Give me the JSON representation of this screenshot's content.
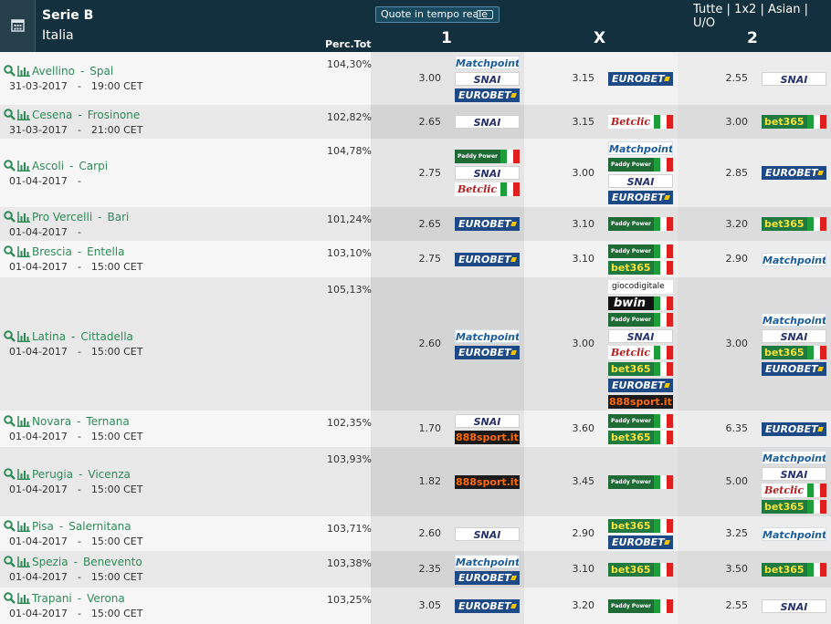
{
  "header": {
    "league": "Serie B",
    "country": "Italia",
    "perc_label": "Perc.Tot",
    "realtime_label": "Quote in tempo reale",
    "filters": [
      "Tutte",
      "1x2",
      "Asian",
      "U/O"
    ],
    "col_1": "1",
    "col_x": "X",
    "col_2": "2"
  },
  "matches": [
    {
      "home": "Avellino",
      "away": "Spal",
      "date": "31-03-2017",
      "sep": "-",
      "time": "19:00 CET",
      "pct": "104,30%",
      "odd1": "3.00",
      "oddx": "3.15",
      "odd2": "2.55",
      "books1": [
        {
          "label": "Matchpoint",
          "type": "matchpoint"
        },
        {
          "label": "SNAI",
          "type": "snai"
        },
        {
          "label": "EUROBET",
          "type": "eurobet"
        }
      ],
      "booksx": [
        {
          "label": "EUROBET",
          "type": "eurobet"
        }
      ],
      "books2": [
        {
          "label": "SNAI",
          "type": "snai"
        }
      ]
    },
    {
      "home": "Cesena",
      "away": "Frosinone",
      "date": "31-03-2017",
      "sep": "-",
      "time": "21:00 CET",
      "pct": "102,82%",
      "odd1": "2.65",
      "oddx": "3.15",
      "odd2": "3.00",
      "books1": [
        {
          "label": "SNAI",
          "type": "snai"
        }
      ],
      "booksx": [
        {
          "label": "Betclic",
          "type": "betclic",
          "flag": true
        }
      ],
      "books2": [
        {
          "label": "bet365",
          "type": "bet365",
          "flag": true
        }
      ]
    },
    {
      "home": "Ascoli",
      "away": "Carpi",
      "date": "01-04-2017",
      "sep": "-",
      "time": "",
      "pct": "104,78%",
      "odd1": "2.75",
      "oddx": "3.00",
      "odd2": "2.85",
      "books1": [
        {
          "label": "Paddy Power",
          "type": "paddy",
          "flag": true
        },
        {
          "label": "SNAI",
          "type": "snai"
        },
        {
          "label": "Betclic",
          "type": "betclic",
          "flag": true
        }
      ],
      "booksx": [
        {
          "label": "Matchpoint",
          "type": "matchpoint"
        },
        {
          "label": "Paddy Power",
          "type": "paddy",
          "flag": true
        },
        {
          "label": "SNAI",
          "type": "snai"
        },
        {
          "label": "EUROBET",
          "type": "eurobet"
        }
      ],
      "books2": [
        {
          "label": "EUROBET",
          "type": "eurobet"
        }
      ]
    },
    {
      "home": "Pro Vercelli",
      "away": "Bari",
      "date": "01-04-2017",
      "sep": "-",
      "time": "",
      "pct": "101,24%",
      "odd1": "2.65",
      "oddx": "3.10",
      "odd2": "3.20",
      "books1": [
        {
          "label": "EUROBET",
          "type": "eurobet"
        }
      ],
      "booksx": [
        {
          "label": "Paddy Power",
          "type": "paddy",
          "flag": true
        }
      ],
      "books2": [
        {
          "label": "bet365",
          "type": "bet365",
          "flag": true
        }
      ]
    },
    {
      "home": "Brescia",
      "away": "Entella",
      "date": "01-04-2017",
      "sep": "-",
      "time": "15:00 CET",
      "pct": "103,10%",
      "odd1": "2.75",
      "oddx": "3.10",
      "odd2": "2.90",
      "books1": [
        {
          "label": "EUROBET",
          "type": "eurobet"
        }
      ],
      "booksx": [
        {
          "label": "Paddy Power",
          "type": "paddy",
          "flag": true
        },
        {
          "label": "bet365",
          "type": "bet365",
          "flag": true
        }
      ],
      "books2": [
        {
          "label": "Matchpoint",
          "type": "matchpoint"
        }
      ]
    },
    {
      "home": "Latina",
      "away": "Cittadella",
      "date": "01-04-2017",
      "sep": "-",
      "time": "15:00 CET",
      "pct": "105,13%",
      "odd1": "2.60",
      "oddx": "3.00",
      "odd2": "3.00",
      "books1": [
        {
          "label": "Matchpoint",
          "type": "matchpoint"
        },
        {
          "label": "EUROBET",
          "type": "eurobet"
        }
      ],
      "booksx": [
        {
          "label": "giocodigitale",
          "type": "giocodigitale"
        },
        {
          "label": "bwin",
          "type": "bwin",
          "flag": true
        },
        {
          "label": "Paddy Power",
          "type": "paddy",
          "flag": true
        },
        {
          "label": "SNAI",
          "type": "snai"
        },
        {
          "label": "Betclic",
          "type": "betclic",
          "flag": true
        },
        {
          "label": "bet365",
          "type": "bet365",
          "flag": true
        },
        {
          "label": "EUROBET",
          "type": "eurobet"
        },
        {
          "label": "888sport.it",
          "type": "sport888"
        }
      ],
      "books2": [
        {
          "label": "Matchpoint",
          "type": "matchpoint"
        },
        {
          "label": "SNAI",
          "type": "snai"
        },
        {
          "label": "bet365",
          "type": "bet365",
          "flag": true
        },
        {
          "label": "EUROBET",
          "type": "eurobet"
        }
      ]
    },
    {
      "home": "Novara",
      "away": "Ternana",
      "date": "01-04-2017",
      "sep": "-",
      "time": "15:00 CET",
      "pct": "102,35%",
      "odd1": "1.70",
      "oddx": "3.60",
      "odd2": "6.35",
      "books1": [
        {
          "label": "SNAI",
          "type": "snai"
        },
        {
          "label": "888sport.it",
          "type": "sport888"
        }
      ],
      "booksx": [
        {
          "label": "Paddy Power",
          "type": "paddy",
          "flag": true
        },
        {
          "label": "bet365",
          "type": "bet365",
          "flag": true
        }
      ],
      "books2": [
        {
          "label": "EUROBET",
          "type": "eurobet"
        }
      ]
    },
    {
      "home": "Perugia",
      "away": "Vicenza",
      "date": "01-04-2017",
      "sep": "-",
      "time": "15:00 CET",
      "pct": "103,93%",
      "odd1": "1.82",
      "oddx": "3.45",
      "odd2": "5.00",
      "books1": [
        {
          "label": "888sport.it",
          "type": "sport888"
        }
      ],
      "booksx": [
        {
          "label": "Paddy Power",
          "type": "paddy",
          "flag": true
        }
      ],
      "books2": [
        {
          "label": "Matchpoint",
          "type": "matchpoint"
        },
        {
          "label": "SNAI",
          "type": "snai"
        },
        {
          "label": "Betclic",
          "type": "betclic",
          "flag": true
        },
        {
          "label": "bet365",
          "type": "bet365",
          "flag": true
        }
      ]
    },
    {
      "home": "Pisa",
      "away": "Salernitana",
      "date": "01-04-2017",
      "sep": "-",
      "time": "15:00 CET",
      "pct": "103,71%",
      "odd1": "2.60",
      "oddx": "2.90",
      "odd2": "3.25",
      "books1": [
        {
          "label": "SNAI",
          "type": "snai"
        }
      ],
      "booksx": [
        {
          "label": "bet365",
          "type": "bet365",
          "flag": true
        },
        {
          "label": "EUROBET",
          "type": "eurobet"
        }
      ],
      "books2": [
        {
          "label": "Matchpoint",
          "type": "matchpoint"
        }
      ]
    },
    {
      "home": "Spezia",
      "away": "Benevento",
      "date": "01-04-2017",
      "sep": "-",
      "time": "15:00 CET",
      "pct": "103,38%",
      "odd1": "2.35",
      "oddx": "3.10",
      "odd2": "3.50",
      "books1": [
        {
          "label": "Matchpoint",
          "type": "matchpoint"
        },
        {
          "label": "EUROBET",
          "type": "eurobet"
        }
      ],
      "booksx": [
        {
          "label": "bet365",
          "type": "bet365",
          "flag": true
        }
      ],
      "books2": [
        {
          "label": "bet365",
          "type": "bet365",
          "flag": true
        }
      ]
    },
    {
      "home": "Trapani",
      "away": "Verona",
      "date": "01-04-2017",
      "sep": "-",
      "time": "15:00 CET",
      "pct": "103,25%",
      "odd1": "3.05",
      "oddx": "3.20",
      "odd2": "2.55",
      "books1": [
        {
          "label": "EUROBET",
          "type": "eurobet"
        }
      ],
      "booksx": [
        {
          "label": "Paddy Power",
          "type": "paddy",
          "flag": true
        }
      ],
      "books2": [
        {
          "label": "SNAI",
          "type": "snai"
        }
      ]
    }
  ]
}
